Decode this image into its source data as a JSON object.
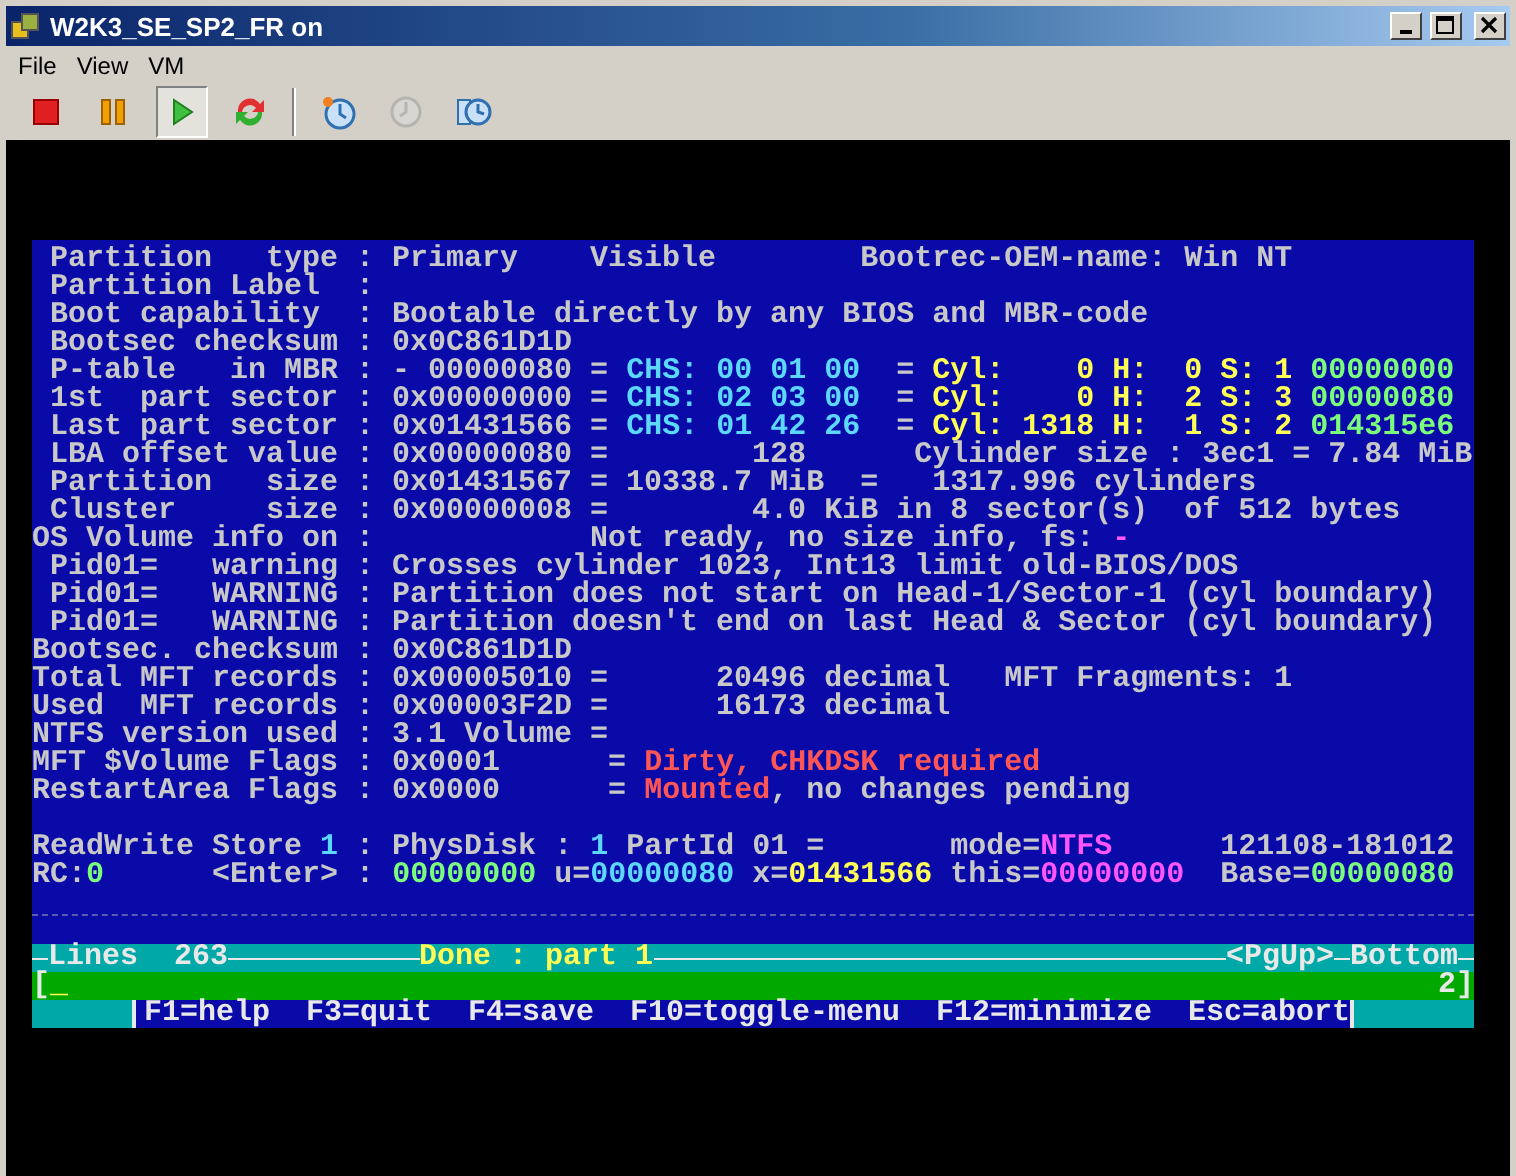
{
  "window": {
    "title": "W2K3_SE_SP2_FR on"
  },
  "menu": [
    {
      "label": "File"
    },
    {
      "label": "View"
    },
    {
      "label": "VM"
    }
  ],
  "toolbar": [
    {
      "kind": "stop",
      "pressed": false,
      "disabled": false
    },
    {
      "kind": "pause",
      "pressed": false,
      "disabled": false
    },
    {
      "kind": "play",
      "pressed": true,
      "disabled": false
    },
    {
      "kind": "reset",
      "pressed": false,
      "disabled": false
    },
    {
      "kind": "snapshot",
      "pressed": false,
      "disabled": false
    },
    {
      "kind": "revert",
      "pressed": false,
      "disabled": true
    },
    {
      "kind": "manager",
      "pressed": false,
      "disabled": false
    }
  ],
  "console": {
    "info_lines": [
      {
        "segments": [
          {
            "text": " Partition   type : Primary    Visible        Bootrec-OEM-name: Win NT",
            "color": "#c8c8c8"
          }
        ]
      },
      {
        "segments": [
          {
            "text": " Partition Label  :",
            "color": "#c8c8c8"
          }
        ]
      },
      {
        "segments": [
          {
            "text": " Boot capability  : Bootable directly by any BIOS and MBR-code",
            "color": "#c8c8c8"
          }
        ]
      },
      {
        "segments": [
          {
            "text": " Bootsec checksum : 0x0C861D1D",
            "color": "#c8c8c8"
          }
        ]
      },
      {
        "segments": [
          {
            "text": " P-table   in MBR : - 00000080 = ",
            "color": "#c8c8c8"
          },
          {
            "text": "CHS: 00 01 00",
            "color": "#5cd8ff"
          },
          {
            "text": "  = ",
            "color": "#c8c8c8"
          },
          {
            "text": "Cyl:    0 H:  0 S: 1",
            "color": "#ffff55"
          },
          {
            "text": " 00000000",
            "color": "#7cfc7c"
          }
        ]
      },
      {
        "segments": [
          {
            "text": " 1st  part sector : 0x00000000 = ",
            "color": "#c8c8c8"
          },
          {
            "text": "CHS: 02 03 00",
            "color": "#5cd8ff"
          },
          {
            "text": "  = ",
            "color": "#c8c8c8"
          },
          {
            "text": "Cyl:    0 H:  2 S: 3",
            "color": "#ffff55"
          },
          {
            "text": " 00000080",
            "color": "#7cfc7c"
          }
        ]
      },
      {
        "segments": [
          {
            "text": " Last part sector : 0x01431566 = ",
            "color": "#c8c8c8"
          },
          {
            "text": "CHS: 01 42 26",
            "color": "#5cd8ff"
          },
          {
            "text": "  = ",
            "color": "#c8c8c8"
          },
          {
            "text": "Cyl: 1318 H:  1 S: 2",
            "color": "#ffff55"
          },
          {
            "text": " 014315e6",
            "color": "#7cfc7c"
          }
        ]
      },
      {
        "segments": [
          {
            "text": " LBA offset value : 0x00000080 =        128      Cylinder size : 3ec1 = 7.84 MiB",
            "color": "#c8c8c8"
          }
        ]
      },
      {
        "segments": [
          {
            "text": " Partition   size : 0x01431567 = 10338.7 MiB  =   1317.996 cylinders",
            "color": "#c8c8c8"
          }
        ]
      },
      {
        "segments": [
          {
            "text": " Cluster     size : 0x00000008 =        4.0 KiB in 8 sector(s)  of 512 bytes",
            "color": "#c8c8c8"
          }
        ]
      },
      {
        "segments": [
          {
            "text": "OS Volume info on :            Not ready, no size info, fs: ",
            "color": "#c8c8c8"
          },
          {
            "text": "-",
            "color": "#ff55ff"
          }
        ]
      },
      {
        "segments": [
          {
            "text": " Pid01=   warning : Crosses cylinder 1023, Int13 limit old-BIOS/DOS",
            "color": "#c8c8c8"
          }
        ]
      },
      {
        "segments": [
          {
            "text": " Pid01=   WARNING : Partition does not start on Head-1/Sector-1 (cyl boundary)",
            "color": "#c8c8c8"
          }
        ]
      },
      {
        "segments": [
          {
            "text": " Pid01=   WARNING : Partition doesn't end on last Head & Sector (cyl boundary)",
            "color": "#c8c8c8"
          }
        ]
      },
      {
        "segments": [
          {
            "text": "Bootsec. checksum : 0x0C861D1D",
            "color": "#c8c8c8"
          }
        ]
      },
      {
        "segments": [
          {
            "text": "Total MFT records : 0x00005010 =      20496 decimal   MFT Fragments: 1",
            "color": "#c8c8c8"
          }
        ]
      },
      {
        "segments": [
          {
            "text": "Used  MFT records : 0x00003F2D =      16173 decimal",
            "color": "#c8c8c8"
          }
        ]
      },
      {
        "segments": [
          {
            "text": "NTFS version used : 3.1 Volume =",
            "color": "#c8c8c8"
          }
        ]
      },
      {
        "segments": [
          {
            "text": "MFT $Volume Flags : 0x0001      = ",
            "color": "#c8c8c8"
          },
          {
            "text": "Dirty, CHKDSK required",
            "color": "#ff5555"
          }
        ]
      },
      {
        "segments": [
          {
            "text": "RestartArea Flags : 0x0000      = ",
            "color": "#c8c8c8"
          },
          {
            "text": "Mounted",
            "color": "#ff5555"
          },
          {
            "text": ", no changes pending",
            "color": "#c8c8c8"
          }
        ]
      }
    ],
    "store_lines": [
      {
        "segments": [
          {
            "text": "ReadWrite Store ",
            "color": "#c8c8c8"
          },
          {
            "text": "1",
            "color": "#5cd8ff"
          },
          {
            "text": " : PhysDisk : ",
            "color": "#c8c8c8"
          },
          {
            "text": "1",
            "color": "#5cd8ff"
          },
          {
            "text": " PartId 01 =       mode=",
            "color": "#c8c8c8"
          },
          {
            "text": "NTFS",
            "color": "#ff55ff"
          },
          {
            "text": "      121108-181012",
            "color": "#c8c8c8"
          }
        ]
      },
      {
        "segments": [
          {
            "text": "RC:",
            "color": "#c8c8c8"
          },
          {
            "text": "0",
            "color": "#7cfc7c"
          },
          {
            "text": "      <Enter> : ",
            "color": "#c8c8c8"
          },
          {
            "text": "00000000",
            "color": "#7cfc7c"
          },
          {
            "text": " u=",
            "color": "#c8c8c8"
          },
          {
            "text": "00000080",
            "color": "#5cd8ff"
          },
          {
            "text": " x=",
            "color": "#c8c8c8"
          },
          {
            "text": "01431566",
            "color": "#ffff55"
          },
          {
            "text": " this=",
            "color": "#c8c8c8"
          },
          {
            "text": "00000000",
            "color": "#ff55ff"
          },
          {
            "text": "  Base=",
            "color": "#c8c8c8"
          },
          {
            "text": "00000080",
            "color": "#7cfc7c"
          }
        ]
      }
    ]
  },
  "status_bar": {
    "lines_label": "Lines",
    "lines_count": "263",
    "message": "Done : part 1",
    "page_key": "<PgUp>",
    "position": "Bottom"
  },
  "input_line": {
    "open_bracket": "[",
    "cursor": "_",
    "page": "2]"
  },
  "function_keys": [
    {
      "label": "F1=help"
    },
    {
      "label": "F3=quit"
    },
    {
      "label": "F4=save"
    },
    {
      "label": "F10=toggle-menu"
    },
    {
      "label": "F12=minimize"
    },
    {
      "label": "Esc=abort"
    }
  ]
}
